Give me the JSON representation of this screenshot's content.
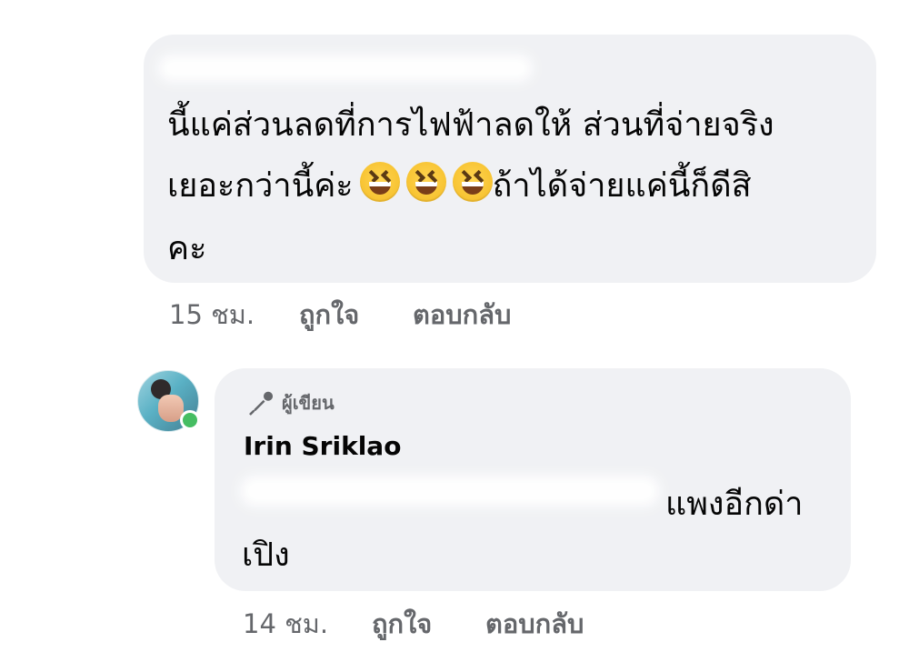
{
  "top_comment": {
    "line1": "นี้แค่ส่วนลดที่การไฟฟ้าลดให้ ส่วนที่จ่ายจริง",
    "line2_before_emojis": "เยอะกว่านี้ค่ะ",
    "line2_after_emojis": "ถ้าได้จ่ายแค่นี้ก็ดีสิ",
    "line3": "คะ",
    "time": "15 ชม.",
    "like_label": "ถูกใจ",
    "reply_label": "ตอบกลับ"
  },
  "reply_comment": {
    "author_badge": "ผู้เขียน",
    "author_name": "Irin Sriklao",
    "line1_visible": "แพงอีกด่า",
    "line2": "เปิง",
    "time": "14 ชม.",
    "like_label": "ถูกใจ",
    "reply_label": "ตอบกลับ"
  },
  "icons": {
    "emoji": "grinning-squinting-face-icon",
    "author": "microphone-icon",
    "online": "online-status-icon"
  },
  "colors": {
    "bubble": "#f0f1f4",
    "text": "#050505",
    "meta": "#65676b",
    "online": "#45bd62"
  }
}
